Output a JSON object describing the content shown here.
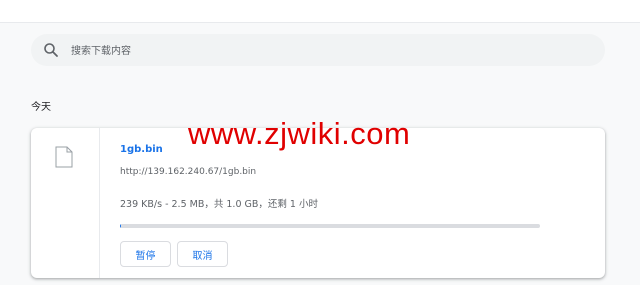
{
  "search": {
    "placeholder": "搜索下载内容",
    "icon": "search-icon"
  },
  "date_group": {
    "label": "今天"
  },
  "download": {
    "filename": "1gb.bin",
    "url": "http://139.162.240.67/1gb.bin",
    "status": "239 KB/s - 2.5 MB，共 1.0 GB，还剩 1 小时",
    "progress": 0.0025,
    "file_icon": "file-icon",
    "buttons": {
      "pause": "暂停",
      "cancel": "取消"
    }
  },
  "watermark": "www.zjwiki.com",
  "colors": {
    "accent": "#1a73e8",
    "watermark": "#e00000",
    "background": "#f8f9fa"
  }
}
